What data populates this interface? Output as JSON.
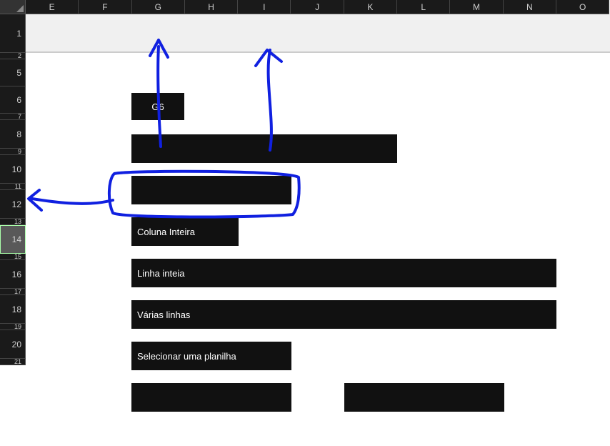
{
  "columns": [
    "E",
    "F",
    "G",
    "H",
    "I",
    "J",
    "K",
    "L",
    "M",
    "N",
    "O"
  ],
  "rows": [
    {
      "n": 1,
      "h": 54,
      "selected": false
    },
    {
      "n": 2,
      "h": 9,
      "selected": false
    },
    {
      "n": 5,
      "h": 38,
      "selected": false
    },
    {
      "n": 6,
      "h": 38,
      "selected": false
    },
    {
      "n": 7,
      "h": 9,
      "selected": false
    },
    {
      "n": 8,
      "h": 40,
      "selected": false
    },
    {
      "n": 9,
      "h": 9,
      "selected": false
    },
    {
      "n": 10,
      "h": 40,
      "selected": false
    },
    {
      "n": 11,
      "h": 9,
      "selected": false
    },
    {
      "n": 12,
      "h": 40,
      "selected": false
    },
    {
      "n": 13,
      "h": 9,
      "selected": false
    },
    {
      "n": 14,
      "h": 40,
      "selected": true
    },
    {
      "n": 15,
      "h": 9,
      "selected": false
    },
    {
      "n": 16,
      "h": 40,
      "selected": false
    },
    {
      "n": 17,
      "h": 9,
      "selected": false
    },
    {
      "n": 18,
      "h": 40,
      "selected": false
    },
    {
      "n": 19,
      "h": 9,
      "selected": false
    },
    {
      "n": 20,
      "h": 40,
      "selected": false
    },
    {
      "n": 21,
      "h": 9,
      "selected": false
    }
  ],
  "cells": {
    "c6": "G6",
    "c8": "",
    "c10": "",
    "c12": "Coluna Inteira",
    "c14": "Linha inteia",
    "c16": "Várias linhas",
    "c18": "Selecionar uma planilha",
    "c20a": "",
    "c20b": ""
  }
}
